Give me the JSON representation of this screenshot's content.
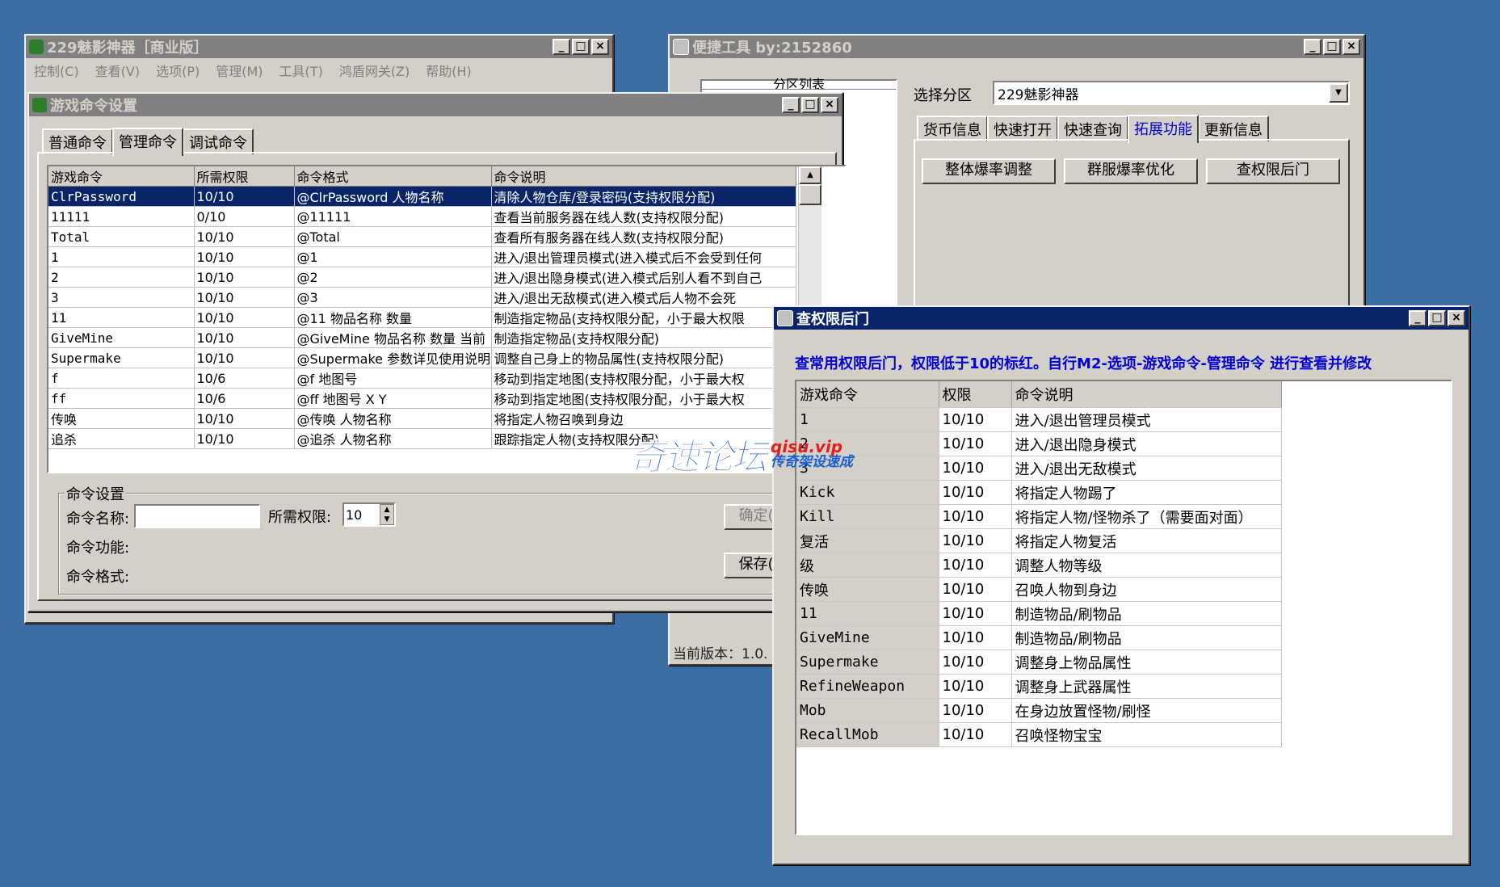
{
  "main_window": {
    "title": "229魅影神器［商业版］",
    "menu": [
      "控制(C)",
      "查看(V)",
      "选项(P)",
      "管理(M)",
      "工具(T)",
      "鸿盾网关(Z)",
      "帮助(H)"
    ]
  },
  "cmd_window": {
    "title": "游戏命令设置",
    "tabs": [
      "普通命令",
      "管理命令",
      "调试命令"
    ],
    "selected_tab": "管理命令",
    "columns": [
      "游戏命令",
      "所需权限",
      "命令格式",
      "命令说明"
    ],
    "rows": [
      {
        "cmd": "ClrPassword",
        "perm": "10/10",
        "fmt": "@ClrPassword 人物名称",
        "desc": "清除人物仓库/登录密码(支持权限分配)"
      },
      {
        "cmd": "11111",
        "perm": "0/10",
        "fmt": "@11111",
        "desc": "查看当前服务器在线人数(支持权限分配)"
      },
      {
        "cmd": "Total",
        "perm": "10/10",
        "fmt": "@Total",
        "desc": "查看所有服务器在线人数(支持权限分配)"
      },
      {
        "cmd": "1",
        "perm": "10/10",
        "fmt": "@1",
        "desc": "进入/退出管理员模式(进入模式后不会受到任何"
      },
      {
        "cmd": "2",
        "perm": "10/10",
        "fmt": "@2",
        "desc": "进入/退出隐身模式(进入模式后别人看不到自己"
      },
      {
        "cmd": "3",
        "perm": "10/10",
        "fmt": "@3",
        "desc": "进入/退出无敌模式(进入模式后人物不会死"
      },
      {
        "cmd": "11",
        "perm": "10/10",
        "fmt": "@11 物品名称 数量",
        "desc": "制造指定物品(支持权限分配，小于最大权限"
      },
      {
        "cmd": "GiveMine",
        "perm": "10/10",
        "fmt": "@GiveMine 物品名称 数量 当前",
        "desc": "制造指定物品(支持权限分配)"
      },
      {
        "cmd": "Supermake",
        "perm": "10/10",
        "fmt": "@Supermake 参数详见使用说明",
        "desc": "调整自己身上的物品属性(支持权限分配)"
      },
      {
        "cmd": "f",
        "perm": "10/6",
        "fmt": "@f 地图号",
        "desc": "移动到指定地图(支持权限分配，小于最大权"
      },
      {
        "cmd": "ff",
        "perm": "10/6",
        "fmt": "@ff 地图号 X Y",
        "desc": "移动到指定地图(支持权限分配，小于最大权"
      },
      {
        "cmd": "传唤",
        "perm": "10/10",
        "fmt": "@传唤 人物名称",
        "desc": "将指定人物召唤到身边"
      },
      {
        "cmd": "追杀",
        "perm": "10/10",
        "fmt": "@追杀 人物名称",
        "desc": "跟踪指定人物(支持权限分配)"
      }
    ],
    "group_title": "命令设置",
    "name_label": "命令名称:",
    "name_value": "",
    "perm_label": "所需权限:",
    "perm_value": "10",
    "func_label": "命令功能:",
    "format_label": "命令格式:",
    "ok_button": "确定(",
    "save_button": "保存("
  },
  "tool_window": {
    "title": "便捷工具  by:2152860",
    "list_header": "分区列表",
    "select_label": "选择分区",
    "select_value": "229魅影神器",
    "tabs": [
      "货币信息",
      "快速打开",
      "快速查询",
      "拓展功能",
      "更新信息"
    ],
    "selected_tab": "拓展功能",
    "buttons": [
      "整体爆率调整",
      "群服爆率优化",
      "查权限后门"
    ],
    "version": "当前版本：1.0."
  },
  "backdoor_window": {
    "title": "查权限后门",
    "notice": "查常用权限后门，权限低于10的标红。自行M2-选项-游戏命令-管理命令 进行查看并修改",
    "columns": [
      "游戏命令",
      "权限",
      "命令说明"
    ],
    "rows": [
      {
        "cmd": "1",
        "perm": "10/10",
        "desc": "进入/退出管理员模式"
      },
      {
        "cmd": "2",
        "perm": "10/10",
        "desc": "进入/退出隐身模式"
      },
      {
        "cmd": "3",
        "perm": "10/10",
        "desc": "进入/退出无敌模式"
      },
      {
        "cmd": "Kick",
        "perm": "10/10",
        "desc": "将指定人物踢了"
      },
      {
        "cmd": "Kill",
        "perm": "10/10",
        "desc": "将指定人物/怪物杀了（需要面对面）"
      },
      {
        "cmd": "复活",
        "perm": "10/10",
        "desc": "将指定人物复活"
      },
      {
        "cmd": "级",
        "perm": "10/10",
        "desc": "调整人物等级"
      },
      {
        "cmd": "传唤",
        "perm": "10/10",
        "desc": "召唤人物到身边"
      },
      {
        "cmd": "11",
        "perm": "10/10",
        "desc": "制造物品/刷物品"
      },
      {
        "cmd": "GiveMine",
        "perm": "10/10",
        "desc": "制造物品/刷物品"
      },
      {
        "cmd": "Supermake",
        "perm": "10/10",
        "desc": "调整身上物品属性"
      },
      {
        "cmd": "RefineWeapon",
        "perm": "10/10",
        "desc": "调整身上武器属性"
      },
      {
        "cmd": "Mob",
        "perm": "10/10",
        "desc": "在身边放置怪物/刷怪"
      },
      {
        "cmd": "RecallMob",
        "perm": "10/10",
        "desc": "召唤怪物宝宝"
      }
    ]
  },
  "watermark": {
    "main": "奇速论坛",
    "domain": "qisu.vip",
    "sub": "传奇架设速成"
  },
  "colors": {
    "desktop": "#3a6ea5",
    "active_title": "#0a246a",
    "inactive_title": "#808080",
    "notice_text": "#0000d0"
  }
}
